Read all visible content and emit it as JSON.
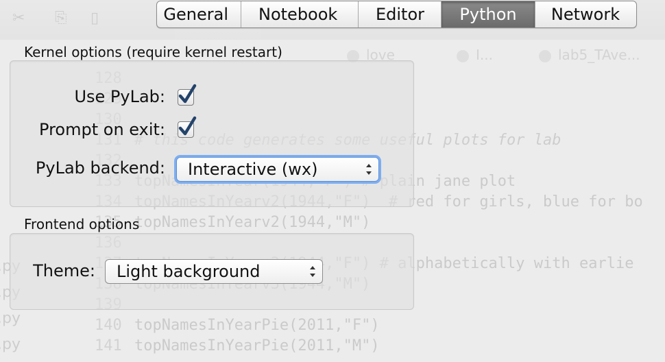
{
  "background": {
    "toolbar_glyphs": [
      "✂",
      "⎘",
      "▯"
    ],
    "tabs": [
      "love",
      "I...",
      "lab5_TAve..."
    ],
    "code_lines": [
      {
        "n": "128",
        "text": ""
      },
      {
        "n": "129",
        "text": ""
      },
      {
        "n": "130",
        "text": ""
      },
      {
        "n": "131",
        "text": "# this code generates some useful plots for lab"
      },
      {
        "n": "132",
        "text": ""
      },
      {
        "n": "133",
        "text": "topNamesInYear(1944,\"F\") # plain jane plot"
      },
      {
        "n": "134",
        "text": "topNamesInYearv2(1944,\"F\")  # red for girls, blue for bo"
      },
      {
        "n": "135",
        "text": "topNamesInYearv2(1944,\"M\")"
      },
      {
        "n": "136",
        "text": ""
      },
      {
        "n": "137",
        "text": "topNamesInYearv3(1944,\"F\") # alphabetically with earlie"
      },
      {
        "n": "138",
        "text": "topNamesInYearv3(1944,\"M\")"
      },
      {
        "n": "139",
        "text": ""
      },
      {
        "n": "140",
        "text": "topNamesInYearPie(2011,\"F\")"
      },
      {
        "n": "141",
        "text": "topNamesInYearPie(2011,\"M\")"
      }
    ],
    "file_items": [
      ".py",
      ".py",
      ".py",
      ".py"
    ]
  },
  "tabs": {
    "general": "General",
    "notebook": "Notebook",
    "editor": "Editor",
    "python": "Python",
    "network": "Network",
    "active": "python"
  },
  "kernel": {
    "title": "Kernel options (require kernel restart)",
    "use_pylab_label": "Use PyLab:",
    "use_pylab_checked": true,
    "prompt_on_exit_label": "Prompt on exit:",
    "prompt_on_exit_checked": true,
    "backend_label": "PyLab backend:",
    "backend_value": "Interactive (wx)"
  },
  "frontend": {
    "title": "Frontend options",
    "theme_label": "Theme:",
    "theme_value": "Light background"
  },
  "colors": {
    "check_mark": "#23436b",
    "focus_ring": "#7eaef0",
    "active_tab": "#7a7a7a"
  }
}
